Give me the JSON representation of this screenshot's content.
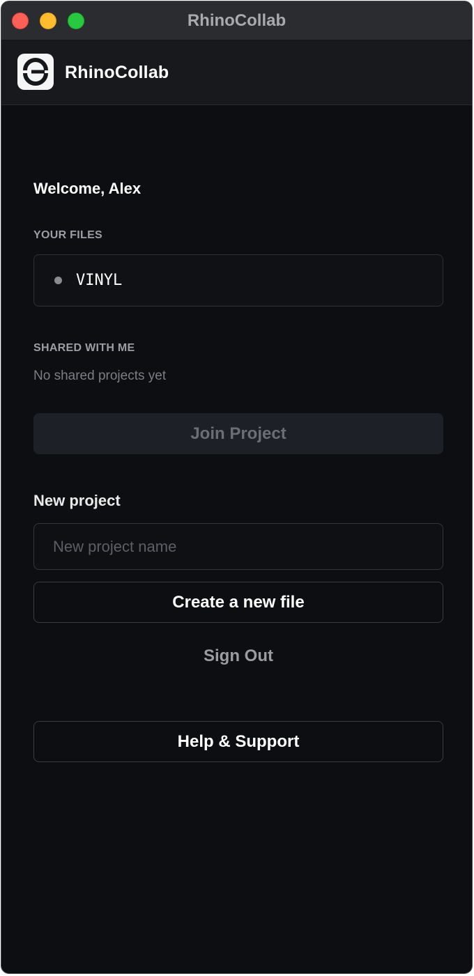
{
  "window": {
    "title": "RhinoCollab"
  },
  "header": {
    "brand": "RhinoCollab",
    "logo_icon": "sync-circle-icon"
  },
  "main": {
    "welcome": "Welcome, Alex",
    "your_files_label": "YOUR FILES",
    "files": [
      {
        "name": "VINYL",
        "status_color": "#8a8b8e"
      }
    ],
    "shared_label": "SHARED WITH ME",
    "shared_empty_text": "No shared projects yet",
    "join_button": "Join Project",
    "new_project_title": "New project",
    "new_project_placeholder": "New project name",
    "new_project_value": "",
    "create_button": "Create a new file",
    "sign_out": "Sign Out",
    "help_button": "Help & Support"
  },
  "colors": {
    "background": "#0d0e11",
    "header_background": "#17191c",
    "titlebar": "#2b2c2f",
    "muted_button": "#1d2026"
  }
}
